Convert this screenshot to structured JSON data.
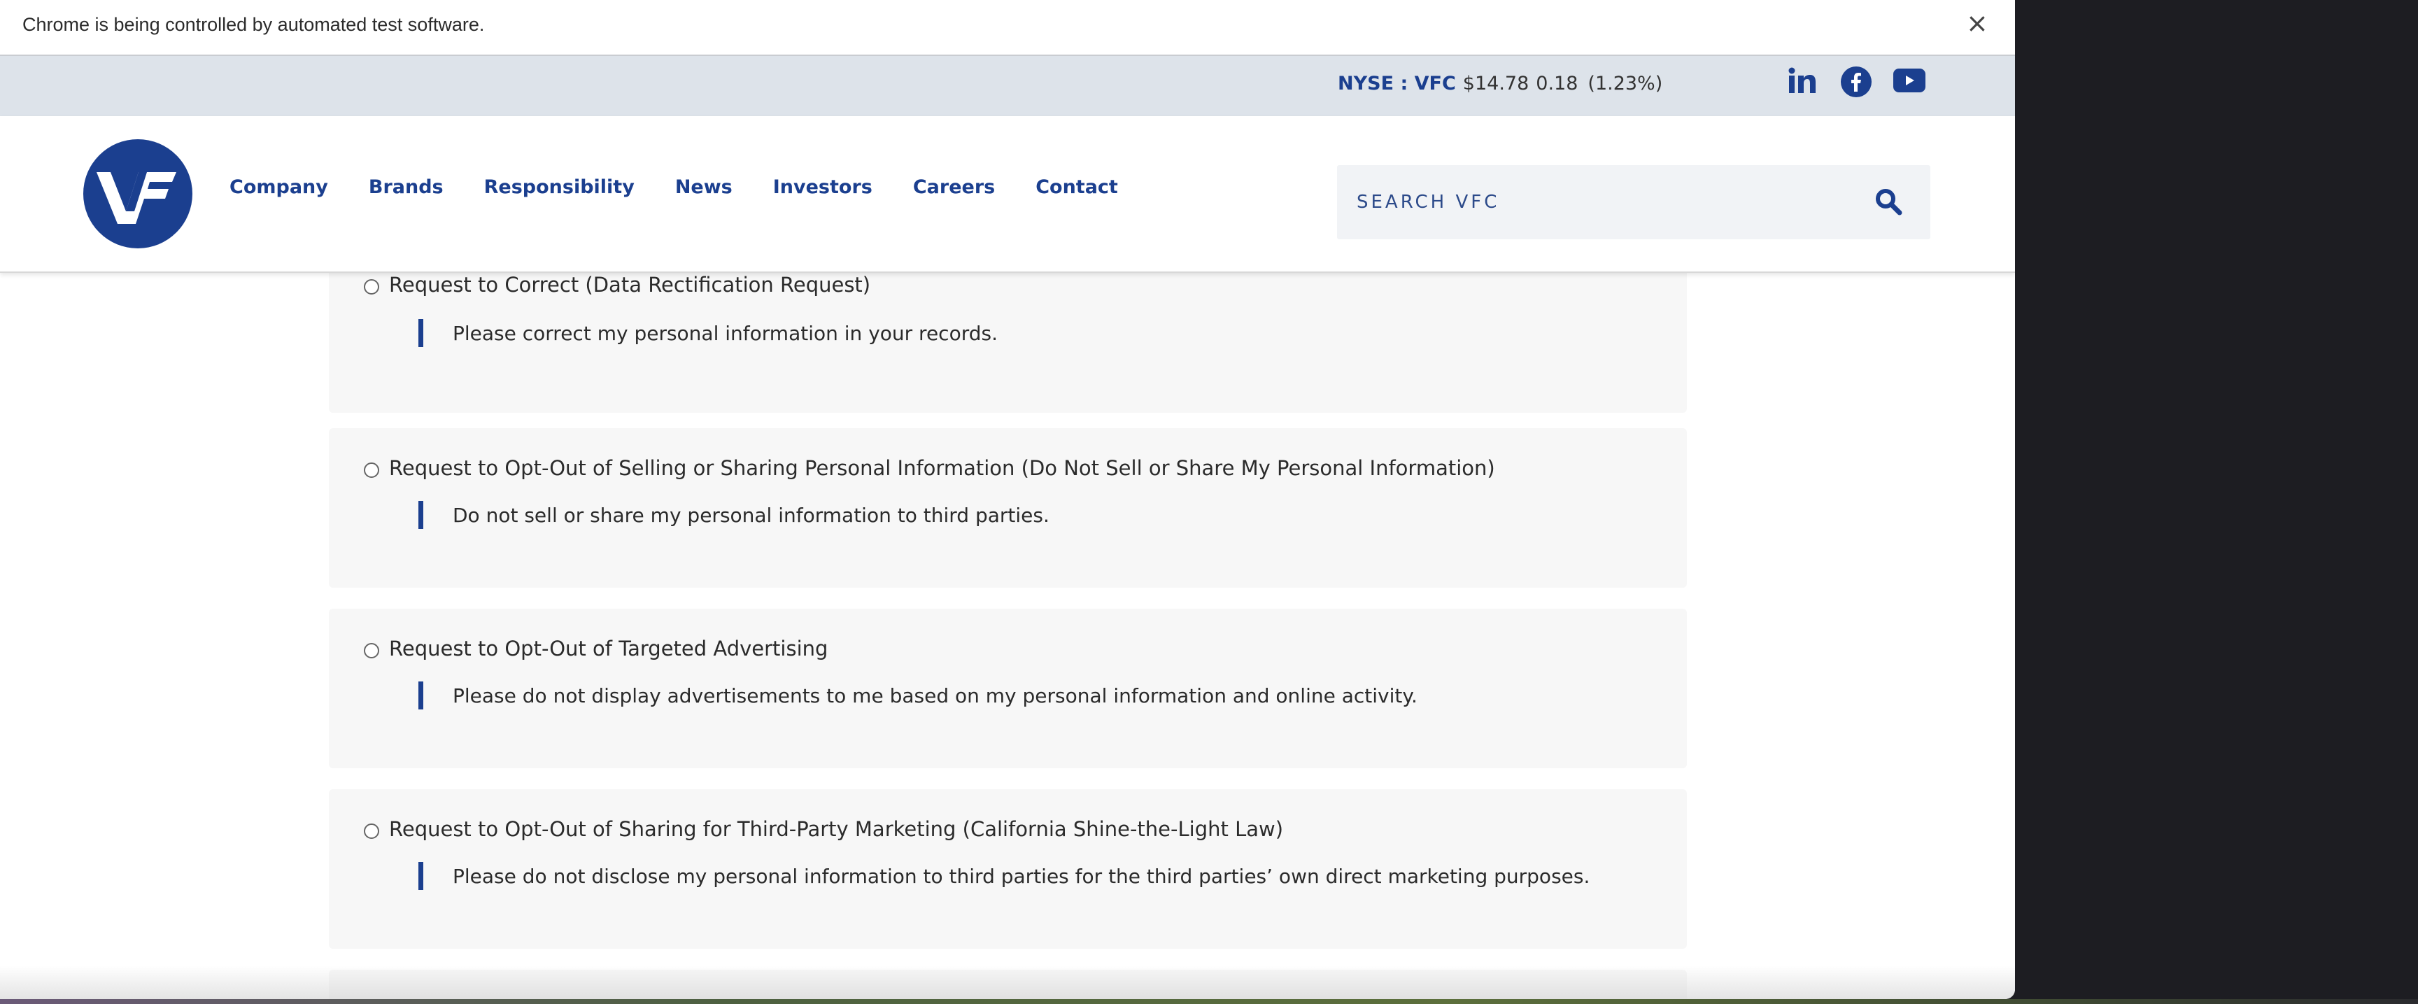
{
  "browser": {
    "automation_message": "Chrome is being controlled by automated test software.",
    "close_glyph": "×"
  },
  "topbar": {
    "stock": {
      "symbol": "NYSE : VFC",
      "price": "$14.78",
      "change": "0.18",
      "percent": "(1.23%)"
    },
    "social": [
      "linkedin-icon",
      "facebook-icon",
      "youtube-icon"
    ]
  },
  "header": {
    "logo_alt": "VF",
    "nav": [
      "Company",
      "Brands",
      "Responsibility",
      "News",
      "Investors",
      "Careers",
      "Contact"
    ],
    "search": {
      "placeholder": "SEARCH VFC",
      "value": ""
    }
  },
  "colors": {
    "brand_blue": "#1b3f8f",
    "card_bg": "#f7f7f7",
    "topbar_bg": "#dde3ea"
  },
  "options": [
    {
      "label": "Request to Correct (Data Rectification Request)",
      "description": "Please correct my personal information in your records."
    },
    {
      "label": "Request to Opt-Out of Selling or Sharing Personal Information (Do Not Sell or Share My Personal Information)",
      "description": "Do not sell or share my personal information to third parties."
    },
    {
      "label": "Request to Opt-Out of Targeted Advertising",
      "description": "Please do not display advertisements to me based on my personal information and online activity."
    },
    {
      "label": "Request to Opt-Out of Sharing for Third-Party Marketing (California Shine-the-Light Law)",
      "description": "Please do not disclose my personal information to third parties for the third parties’ own direct marketing purposes."
    }
  ]
}
